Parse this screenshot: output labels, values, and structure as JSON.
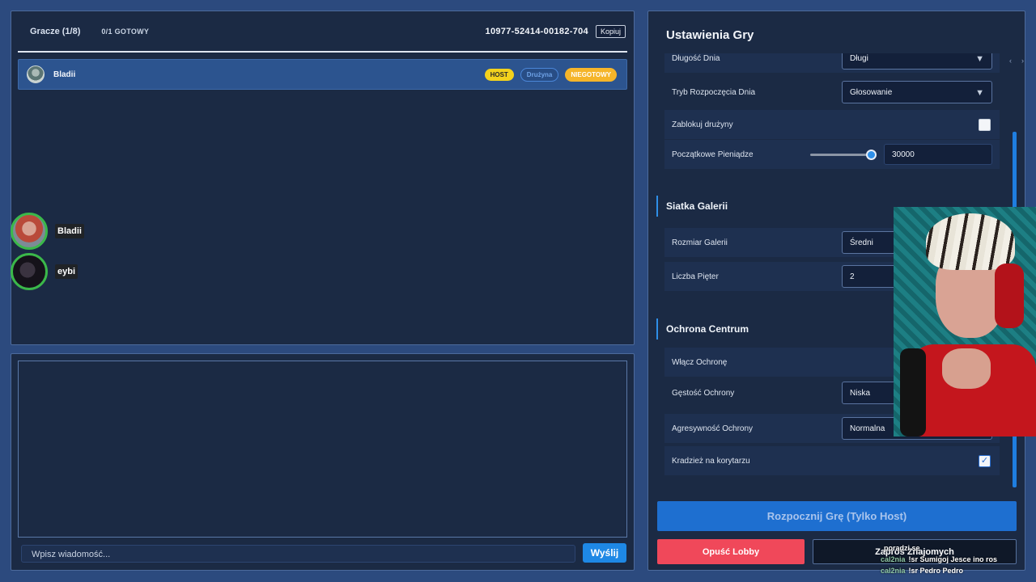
{
  "players": {
    "title": "Gracze (1/8)",
    "ready_count": "0/1 GOTOWY",
    "lobby_code": "10977-52414-00182-704",
    "copy_label": "Kopiuj",
    "list": [
      {
        "name": "Bladii",
        "badge_host": "HOST",
        "badge_team": "Drużyna",
        "badge_status": "NIEGOTOWY"
      }
    ]
  },
  "voice": [
    {
      "name": "Bladii"
    },
    {
      "name": "eybi"
    }
  ],
  "chat": {
    "placeholder": "Wpisz wiadomość...",
    "send_label": "Wyślij"
  },
  "settings": {
    "title": "Ustawienia Gry",
    "rows": {
      "day_length": {
        "label": "Długość Dnia",
        "value": "Długi"
      },
      "day_start_mode": {
        "label": "Tryb Rozpoczęcia Dnia",
        "value": "Głosowanie"
      },
      "lock_teams": {
        "label": "Zablokuj drużyny",
        "checked": false
      },
      "starting_money": {
        "label": "Początkowe Pieniądze",
        "value": "30000",
        "slider_fraction": 1.0
      }
    },
    "gallery": {
      "title": "Siatka Galerii",
      "size": {
        "label": "Rozmiar Galerii",
        "value": "Średni"
      },
      "floors": {
        "label": "Liczba Pięter",
        "value": "2"
      }
    },
    "protection": {
      "title": "Ochrona Centrum",
      "enable": {
        "label": "Włącz Ochronę"
      },
      "density": {
        "label": "Gęstość Ochrony",
        "value": "Niska"
      },
      "aggression": {
        "label": "Agresywność Ochrony",
        "value": "Normalna"
      },
      "theft": {
        "label": "Kradzież na korytarzu",
        "checked": true
      }
    },
    "start_label": "Rozpocznij Grę (Tylko Host)",
    "leave_label": "Opuść Lobby",
    "invite_label": "Zaproś Znajomych"
  },
  "stream_chat": [
    {
      "user": "",
      "text": "poradzi se"
    },
    {
      "user": "cal2nia",
      "text": "!sr Sumigoj Jesce ino ros"
    },
    {
      "user": "cal2nia",
      "text": "!sr Pedro Pedro"
    }
  ],
  "colors": {
    "background": "#2c4a7e",
    "panel": "#1b2a44",
    "accent": "#1e88e5",
    "host_badge": "#f3d21d",
    "notready_badge": "#f5b52a",
    "leave_button": "#f0485a"
  }
}
